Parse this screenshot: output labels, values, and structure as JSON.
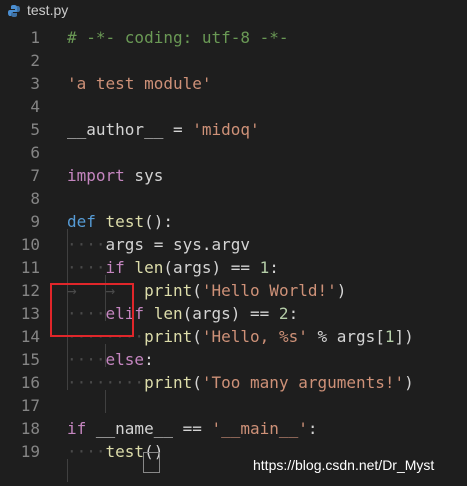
{
  "tab": {
    "title": "test.py",
    "icon": "python-file-icon"
  },
  "lines": [
    {
      "number": "1"
    },
    {
      "number": "2"
    },
    {
      "number": "3"
    },
    {
      "number": "4"
    },
    {
      "number": "5"
    },
    {
      "number": "6"
    },
    {
      "number": "7"
    },
    {
      "number": "8"
    },
    {
      "number": "9"
    },
    {
      "number": "10"
    },
    {
      "number": "11"
    },
    {
      "number": "12"
    },
    {
      "number": "13"
    },
    {
      "number": "14"
    },
    {
      "number": "15"
    },
    {
      "number": "16"
    },
    {
      "number": "17"
    },
    {
      "number": "18"
    },
    {
      "number": "19"
    }
  ],
  "code": {
    "l1": "# -*- coding: utf-8 -*-",
    "l3": "'a test module'",
    "l5_var": "__author__",
    "l5_op": " = ",
    "l5_str": "'midoq'",
    "l7_kw": "import",
    "l7_mod": " sys",
    "l9_kw": "def",
    "l9_fn": "test",
    "l9_rest": "():",
    "l10_indent": "····",
    "l10_var": "args",
    "l10_rest": " = sys.argv",
    "l11_indent": "····",
    "l11_kw": "if",
    "l11_fn": " len",
    "l11_rest": "(args) == ",
    "l11_num": "1",
    "l11_colon": ":",
    "l12_tabs": "→   →   ",
    "l12_fn": "print",
    "l12_p1": "(",
    "l12_str": "'Hello World!'",
    "l12_p2": ")",
    "l13_indent": "····",
    "l13_kw": "elif",
    "l13_fn": " len",
    "l13_rest": "(args) == ",
    "l13_num": "2",
    "l13_colon": ":",
    "l14_indent": "········",
    "l14_fn": "print",
    "l14_p1": "(",
    "l14_str": "'Hello, %s'",
    "l14_rest": " % args[",
    "l14_num": "1",
    "l14_p2": "])",
    "l15_indent": "····",
    "l15_kw": "else",
    "l15_colon": ":",
    "l16_indent": "········",
    "l16_fn": "print",
    "l16_p1": "(",
    "l16_str": "'Too many arguments!'",
    "l16_p2": ")",
    "l18_kw": "if",
    "l18_var": " __name__",
    "l18_op": " == ",
    "l18_str": "'__main__'",
    "l18_colon": ":",
    "l19_indent": "····",
    "l19_fn": "test",
    "l19_rest": "()"
  },
  "watermark": "https://blog.csdn.net/Dr_Myst",
  "colors": {
    "background": "#1e1e1e",
    "comment": "#6a9955",
    "string": "#ce9178",
    "keyword": "#c586c0",
    "function": "#dcdcaa",
    "highlight_box": "#e0262a"
  }
}
